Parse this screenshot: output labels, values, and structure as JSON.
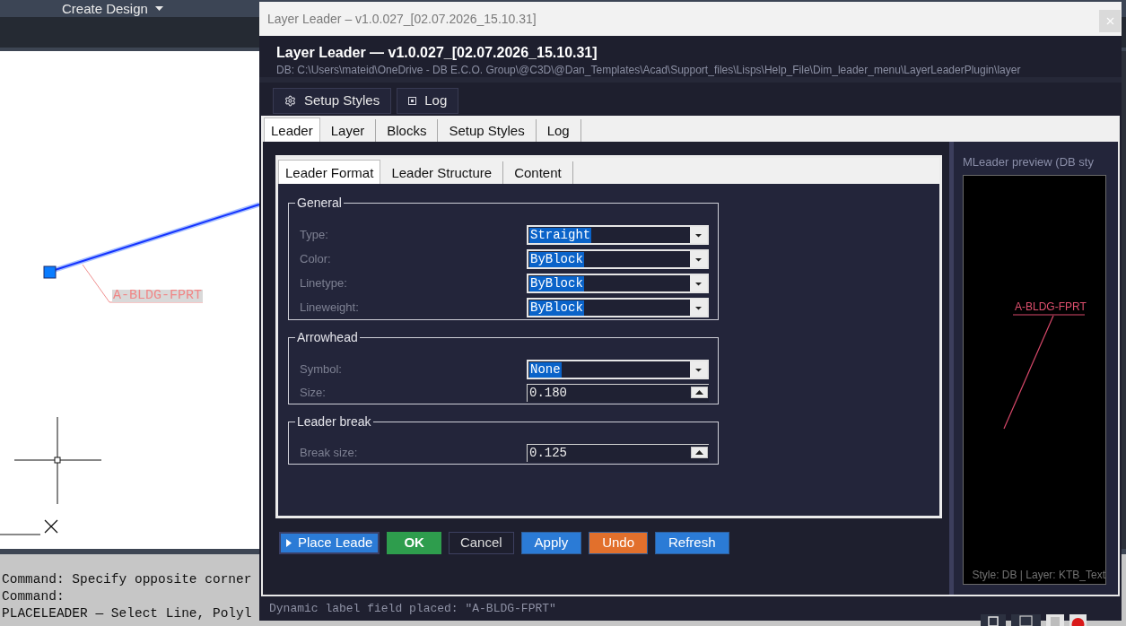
{
  "cad": {
    "ribbon_menu": {
      "label": "Create Design"
    },
    "drawing": {
      "leader_label": "A-BLDG-FPRT"
    },
    "command_lines": [
      "Command: Specify opposite corner",
      "Command:",
      "PLACELEADER — Select Line, Polyl"
    ]
  },
  "window": {
    "title": "Layer Leader – v1.0.027_[02.07.2026_15.10.31]"
  },
  "header": {
    "title": "Layer Leader — v1.0.027_[02.07.2026_15.10.31]",
    "path": "DB: C:\\Users\\mateid\\OneDrive - DB E.C.O. Group\\@C3D\\@Dan_Templates\\Acad\\Support_files\\Lisps\\Help_File\\Dim_leader_menu\\LayerLeaderPlugin\\layer"
  },
  "top_tabs": [
    {
      "label": "Setup Styles"
    },
    {
      "label": "Log"
    }
  ],
  "main_tabs": [
    {
      "label": "Leader",
      "selected": true
    },
    {
      "label": "Layer",
      "selected": false
    },
    {
      "label": "Blocks",
      "selected": false
    },
    {
      "label": "Setup Styles",
      "selected": false
    },
    {
      "label": "Log",
      "selected": false
    }
  ],
  "sub_tabs": [
    {
      "label": "Leader Format",
      "selected": true
    },
    {
      "label": "Leader Structure",
      "selected": false
    },
    {
      "label": "Content",
      "selected": false
    }
  ],
  "groups": [
    {
      "title": "General",
      "fields": [
        {
          "label": "Type:",
          "kind": "combo",
          "value": "Straight",
          "highlighted": true
        },
        {
          "label": "Color:",
          "kind": "combo",
          "value": "ByBlock",
          "highlighted": true
        },
        {
          "label": "Linetype:",
          "kind": "combo",
          "value": "ByBlock",
          "highlighted": true
        },
        {
          "label": "Lineweight:",
          "kind": "combo",
          "value": "ByBlock",
          "highlighted": true
        }
      ]
    },
    {
      "title": "Arrowhead",
      "fields": [
        {
          "label": "Symbol:",
          "kind": "combo",
          "value": "None",
          "highlighted": true
        },
        {
          "label": "Size:",
          "kind": "spin",
          "value": "0.180",
          "highlighted": false
        }
      ]
    },
    {
      "title": "Leader break",
      "fields": [
        {
          "label": "Break size:",
          "kind": "spin",
          "value": "0.125",
          "highlighted": false
        }
      ]
    }
  ],
  "buttons": [
    {
      "label": "Place Leade",
      "kind": "play",
      "color": "#2b7bd6"
    },
    {
      "label": "OK",
      "kind": "default",
      "color": "#2e9d4d"
    },
    {
      "label": "Cancel",
      "kind": "outline"
    },
    {
      "label": "Apply",
      "kind": "fill",
      "color": "#2b7bd6"
    },
    {
      "label": "Undo",
      "kind": "fill",
      "color": "#e2702c"
    },
    {
      "label": "Refresh",
      "kind": "fill",
      "color": "#2b7bd6"
    }
  ],
  "preview": {
    "title": "MLeader preview (DB sty",
    "leader_label": "A-BLDG-FPRT",
    "footer": "Style: DB | Layer: KTB_Text"
  },
  "status_bar": {
    "message": "Dynamic label field placed: \"A-BLDG-FPRT\""
  }
}
